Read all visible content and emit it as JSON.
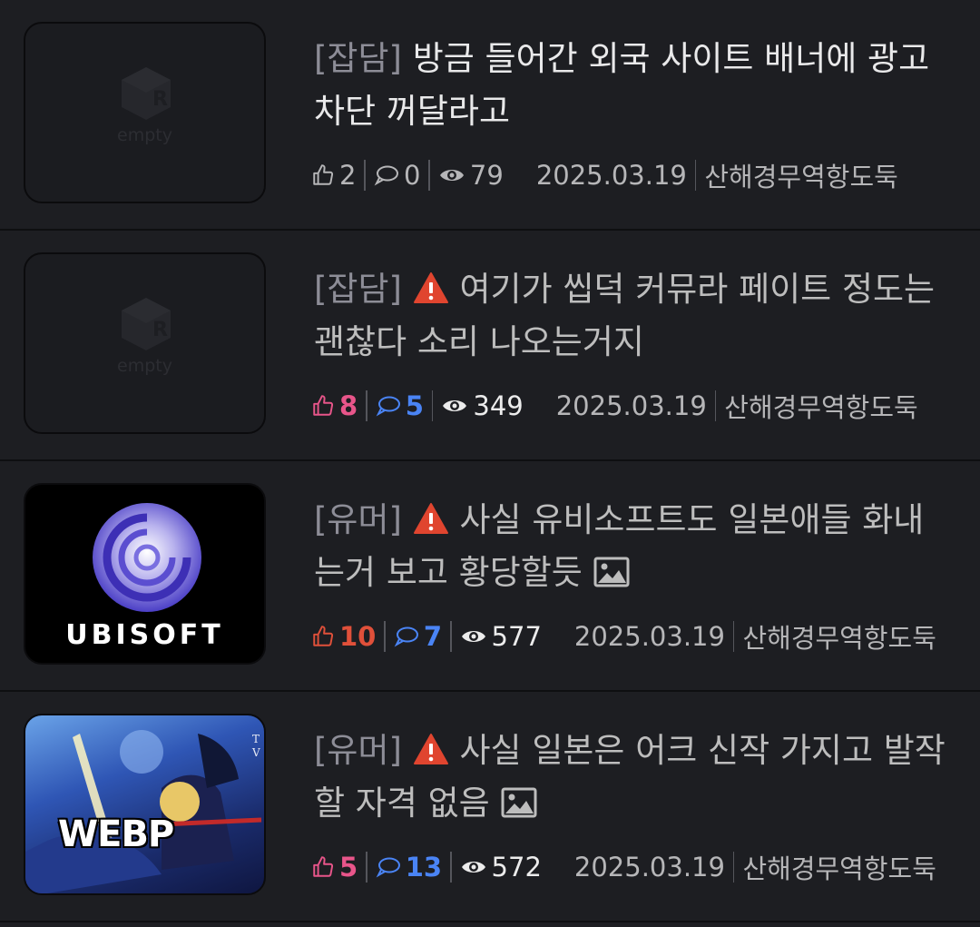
{
  "colors": {
    "background": "#1d1e22",
    "like_pink": "#e8558a",
    "like_red": "#e0503a",
    "comment_blue": "#4a84f5",
    "warning_red": "#e0452f"
  },
  "posts": [
    {
      "thumb": "empty",
      "thumb_text": "empty",
      "category": "[잡담]",
      "warning": false,
      "title": "방금 들어간 외국 사이트 배너에 광고 차단 꺼달라고",
      "has_image": false,
      "likes": "2",
      "comments": "0",
      "views": "79",
      "date": "2025.03.19",
      "author": "산해경무역항도둑"
    },
    {
      "thumb": "empty",
      "thumb_text": "empty",
      "category": "[잡담]",
      "warning": true,
      "title": "여기가 씹덕 커뮤라 페이트 정도는 괜찮다 소리 나오는거지",
      "has_image": false,
      "likes": "8",
      "comments": "5",
      "views": "349",
      "date": "2025.03.19",
      "author": "산해경무역항도둑"
    },
    {
      "thumb": "ubisoft",
      "thumb_text": "UBISOFT",
      "category": "[유머]",
      "warning": true,
      "title": "사실 유비소프트도 일본애들 화내는거 보고 황당할듯",
      "has_image": true,
      "likes": "10",
      "comments": "7",
      "views": "577",
      "date": "2025.03.19",
      "author": "산해경무역항도둑"
    },
    {
      "thumb": "anime",
      "thumb_text": "WEBP",
      "category": "[유머]",
      "warning": true,
      "title": "사실 일본은 어크 신작 가지고 발작할 자격 없음",
      "has_image": true,
      "likes": "5",
      "comments": "13",
      "views": "572",
      "date": "2025.03.19",
      "author": "산해경무역항도둑"
    }
  ],
  "icons": {
    "like": "thumbs-up-icon",
    "comment": "comment-bubble-icon",
    "view": "eye-icon",
    "warning": "warning-triangle-icon",
    "image": "image-icon"
  }
}
